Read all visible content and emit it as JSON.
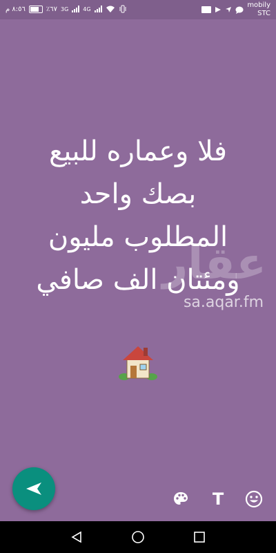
{
  "status_bar": {
    "time": "٨:٥٦ م",
    "battery_percent": "٪٦٧",
    "network_label_1": "3G",
    "network_label_2": "4G",
    "carrier_line_1": "mobily",
    "carrier_line_2": "STC"
  },
  "story": {
    "lines": [
      "فلا وعماره للبيع",
      "بصك واحد",
      "المطلوب مليون",
      "ومئتان الف صافي"
    ],
    "emoji_icon": "house-with-garden-icon"
  },
  "watermark": {
    "logo_text": "عقار",
    "url": "sa.aqar.fm"
  },
  "toolbar": {
    "send_icon": "send-arrow-icon",
    "palette_icon": "palette-icon",
    "text_label": "T",
    "emoji_icon": "smiley-icon"
  },
  "nav": {
    "back_icon": "back-triangle-icon",
    "home_icon": "home-circle-icon",
    "recent_icon": "recent-square-icon"
  },
  "colors": {
    "background": "#8e6b9b",
    "send_button": "#0a8f7e"
  }
}
